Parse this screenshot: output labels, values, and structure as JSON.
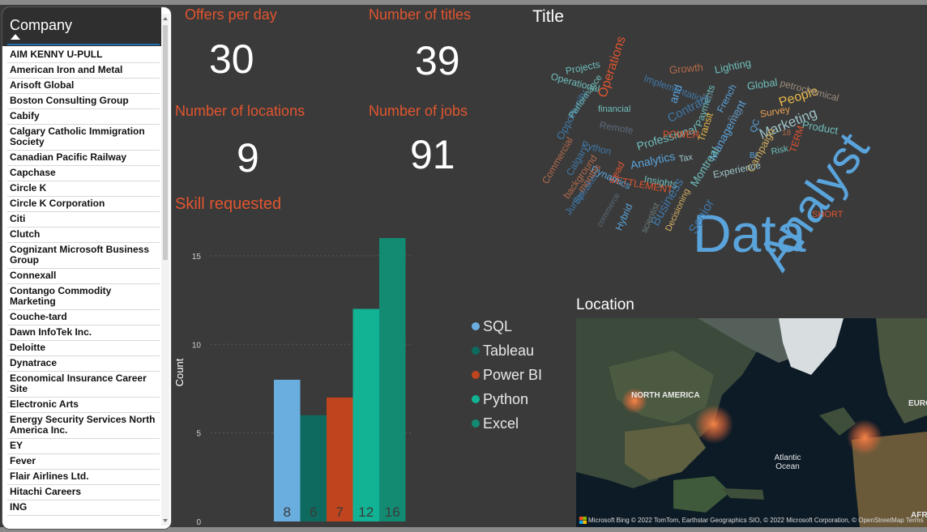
{
  "slicer": {
    "title": "Company",
    "items": [
      "AIM KENNY U-PULL",
      "American Iron and Metal",
      "Arisoft Global",
      "Boston Consulting Group",
      "Cabify",
      "Calgary Catholic Immigration Society",
      "Canadian Pacific Railway",
      "Capchase",
      "Circle K",
      "Circle K Corporation",
      "Citi",
      "Clutch",
      "Cognizant Microsoft Business Group",
      "Connexall",
      "Contango Commodity Marketing",
      "Couche-tard",
      "Dawn InfoTek Inc.",
      "Deloitte",
      "Dynatrace",
      "Economical Insurance Career Site",
      "Electronic Arts",
      "Energy Security Services North America Inc.",
      "EY",
      "Fever",
      "Flair Airlines Ltd.",
      "Hitachi Careers",
      "ING"
    ]
  },
  "kpis": {
    "offers_label": "Offers per day",
    "offers_value": "30",
    "titles_label": "Number of titles",
    "titles_value": "39",
    "locations_label": "Number of locations",
    "locations_value": "9",
    "jobs_label": "Number of jobs",
    "jobs_value": "91"
  },
  "chart_title": "Skill requested",
  "chart_data": {
    "type": "bar",
    "categories": [
      "SQL",
      "Tableau",
      "Power BI",
      "Python",
      "Excel"
    ],
    "values": [
      8,
      6,
      7,
      12,
      16
    ],
    "colors": [
      "#6aaee0",
      "#0e6a5e",
      "#c0451f",
      "#12b394",
      "#138a72"
    ],
    "title": "Skill requested",
    "xlabel": "",
    "ylabel": "Count",
    "ylim": [
      0,
      16
    ],
    "yticks": [
      0,
      5,
      10,
      15
    ],
    "grid": true,
    "legend": "right"
  },
  "wordcloud": {
    "title": "Title",
    "words": [
      {
        "text": "Data",
        "color": "#5aa4dc"
      },
      {
        "text": "Analyst",
        "color": "#5aa4dc"
      },
      {
        "text": "Marketing",
        "color": "#9ec3c8"
      },
      {
        "text": "Operations",
        "color": "#e0552f"
      },
      {
        "text": "People",
        "color": "#e8b94a"
      },
      {
        "text": "Contract",
        "color": "#3f78a8"
      },
      {
        "text": "Professional",
        "color": "#6fbfbc"
      },
      {
        "text": "Analytics",
        "color": "#5aa4dc"
      },
      {
        "text": "Management",
        "color": "#5aa4dc"
      },
      {
        "text": "Campaign",
        "color": "#d4b060"
      },
      {
        "text": "Lighting",
        "color": "#6fbfbc"
      },
      {
        "text": "Growth",
        "color": "#b36a4a"
      },
      {
        "text": "Global",
        "color": "#6fbfbc"
      },
      {
        "text": "petrochemical",
        "color": "#9a8a7a"
      },
      {
        "text": "Projects",
        "color": "#6fbfbc"
      },
      {
        "text": "Operational",
        "color": "#6fbfbc"
      },
      {
        "text": "Implementation",
        "color": "#3f78a8"
      },
      {
        "text": "and",
        "color": "#5aa4dc"
      },
      {
        "text": "Payments",
        "color": "#6fbfbc"
      },
      {
        "text": "French",
        "color": "#5aa4dc"
      },
      {
        "text": "Survey",
        "color": "#e8a050"
      },
      {
        "text": "Product",
        "color": "#6fbfbc"
      },
      {
        "text": "POWER",
        "color": "#e0552f"
      },
      {
        "text": "Transit",
        "color": "#e8b94a"
      },
      {
        "text": "QC",
        "color": "#5aa4dc"
      },
      {
        "text": "Risk",
        "color": "#6fbfbc"
      },
      {
        "text": "TERM",
        "color": "#e0552f"
      },
      {
        "text": "Montreal",
        "color": "#6fbfbc"
      },
      {
        "text": "Experience",
        "color": "#9ec3c8"
      },
      {
        "text": "Tax",
        "color": "#9ec3c8"
      },
      {
        "text": "Insights",
        "color": "#6fbfbc"
      },
      {
        "text": "SETTLEMENT",
        "color": "#e0552f"
      },
      {
        "text": "Python",
        "color": "#3f78a8"
      },
      {
        "text": "Lead",
        "color": "#e0552f"
      },
      {
        "text": "Hybrid",
        "color": "#5aa4dc"
      },
      {
        "text": "Business",
        "color": "#3f78a8"
      },
      {
        "text": "Senior",
        "color": "#3f78a8"
      },
      {
        "text": "Decisioning",
        "color": "#d4b060"
      },
      {
        "text": "scientist",
        "color": "#6a7a7a"
      },
      {
        "text": "Speaker",
        "color": "#3f78a8"
      },
      {
        "text": "background",
        "color": "#b36a4a"
      },
      {
        "text": "Calgary",
        "color": "#3f78a8"
      },
      {
        "text": "Commercial",
        "color": "#b36a4a"
      },
      {
        "text": "Opportunity",
        "color": "#3f78a8"
      },
      {
        "text": "Performance",
        "color": "#6fbfbc"
      },
      {
        "text": "financial",
        "color": "#6fbfbc"
      },
      {
        "text": "Remote",
        "color": "#5a6a7a"
      },
      {
        "text": "SHORT",
        "color": "#e0552f"
      },
      {
        "text": "Dynamics",
        "color": "#5aa4dc"
      },
      {
        "text": "Junior",
        "color": "#3f78a8"
      },
      {
        "text": "months",
        "color": "#b36a4a"
      },
      {
        "text": "AR",
        "color": "#5a6a7a"
      },
      {
        "text": "SAS",
        "color": "#5a6a7a"
      },
      {
        "text": "commerce",
        "color": "#5a6a7a"
      },
      {
        "text": "BI",
        "color": "#5aa4dc"
      },
      {
        "text": "18",
        "color": "#b36a4a"
      }
    ]
  },
  "map": {
    "title": "Location",
    "labels": [
      "NORTH AMERICA",
      "Atlantic Ocean",
      "EURO",
      "AFR"
    ],
    "attribution": "© 2022 TomTom, Earthstar Geographics SIO, © 2022 Microsoft Corporation, © OpenStreetMap   Terms",
    "bing_label": "Microsoft Bing"
  }
}
